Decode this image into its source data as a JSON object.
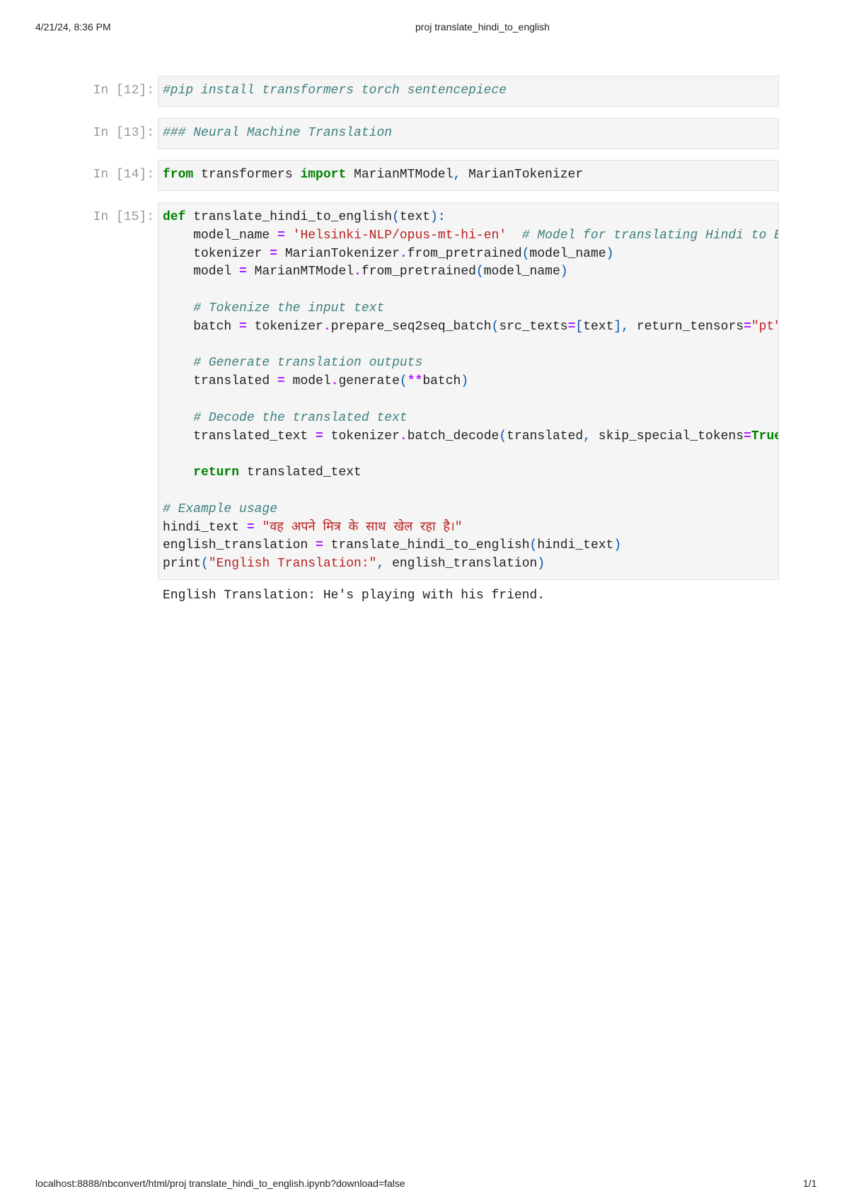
{
  "page_header": {
    "datetime": "4/21/24, 8:36 PM",
    "title": "proj translate_hindi_to_english"
  },
  "page_footer": {
    "url": "localhost:8888/nbconvert/html/proj translate_hindi_to_english.ipynb?download=false",
    "page": "1/1"
  },
  "cells": [
    {
      "prompt": "In [12]:",
      "lines": [
        [
          [
            "cm",
            "#pip install transformers torch sentencepiece"
          ]
        ]
      ]
    },
    {
      "prompt": "In [13]:",
      "lines": [
        [
          [
            "cm",
            "### Neural Machine Translation"
          ]
        ]
      ]
    },
    {
      "prompt": "In [14]:",
      "lines": [
        [
          [
            "kw",
            "from"
          ],
          [
            "n",
            " transformers "
          ],
          [
            "kw",
            "import"
          ],
          [
            "n",
            " MarianMTModel"
          ],
          [
            "p",
            ","
          ],
          [
            "n",
            " MarianTokenizer"
          ]
        ]
      ]
    },
    {
      "prompt": "In [15]:",
      "lines": [
        [
          [
            "kw",
            "def"
          ],
          [
            "n",
            " translate_hindi_to_english"
          ],
          [
            "p",
            "("
          ],
          [
            "n",
            "text"
          ],
          [
            "p",
            "):"
          ]
        ],
        [
          [
            "n",
            "    model_name "
          ],
          [
            "op",
            "="
          ],
          [
            "n",
            " "
          ],
          [
            "str",
            "'Helsinki-NLP/opus-mt-hi-en'"
          ],
          [
            "n",
            "  "
          ],
          [
            "cm",
            "# Model for translating Hindi to English"
          ]
        ],
        [
          [
            "n",
            "    tokenizer "
          ],
          [
            "op",
            "="
          ],
          [
            "n",
            " MarianTokenizer"
          ],
          [
            "op",
            "."
          ],
          [
            "n",
            "from_pretrained"
          ],
          [
            "p",
            "("
          ],
          [
            "n",
            "model_name"
          ],
          [
            "p",
            ")"
          ]
        ],
        [
          [
            "n",
            "    model "
          ],
          [
            "op",
            "="
          ],
          [
            "n",
            " MarianMTModel"
          ],
          [
            "op",
            "."
          ],
          [
            "n",
            "from_pretrained"
          ],
          [
            "p",
            "("
          ],
          [
            "n",
            "model_name"
          ],
          [
            "p",
            ")"
          ]
        ],
        [
          [
            "n",
            " "
          ]
        ],
        [
          [
            "n",
            "    "
          ],
          [
            "cm",
            "# Tokenize the input text"
          ]
        ],
        [
          [
            "n",
            "    batch "
          ],
          [
            "op",
            "="
          ],
          [
            "n",
            " tokenizer"
          ],
          [
            "op",
            "."
          ],
          [
            "n",
            "prepare_seq2seq_batch"
          ],
          [
            "p",
            "("
          ],
          [
            "n",
            "src_texts"
          ],
          [
            "op",
            "="
          ],
          [
            "p",
            "["
          ],
          [
            "n",
            "text"
          ],
          [
            "p",
            "],"
          ],
          [
            "n",
            " return_tensors"
          ],
          [
            "op",
            "="
          ],
          [
            "str",
            "\"pt\""
          ],
          [
            "p",
            ")"
          ]
        ],
        [
          [
            "n",
            " "
          ]
        ],
        [
          [
            "n",
            "    "
          ],
          [
            "cm",
            "# Generate translation outputs"
          ]
        ],
        [
          [
            "n",
            "    translated "
          ],
          [
            "op",
            "="
          ],
          [
            "n",
            " model"
          ],
          [
            "op",
            "."
          ],
          [
            "n",
            "generate"
          ],
          [
            "p",
            "("
          ],
          [
            "op",
            "**"
          ],
          [
            "n",
            "batch"
          ],
          [
            "p",
            ")"
          ]
        ],
        [
          [
            "n",
            " "
          ]
        ],
        [
          [
            "n",
            "    "
          ],
          [
            "cm",
            "# Decode the translated text"
          ]
        ],
        [
          [
            "n",
            "    translated_text "
          ],
          [
            "op",
            "="
          ],
          [
            "n",
            " tokenizer"
          ],
          [
            "op",
            "."
          ],
          [
            "n",
            "batch_decode"
          ],
          [
            "p",
            "("
          ],
          [
            "n",
            "translated"
          ],
          [
            "p",
            ","
          ],
          [
            "n",
            " skip_special_tokens"
          ],
          [
            "op",
            "="
          ],
          [
            "kw",
            "True"
          ],
          [
            "p",
            ")"
          ]
        ],
        [
          [
            "n",
            " "
          ]
        ],
        [
          [
            "n",
            "    "
          ],
          [
            "kw",
            "return"
          ],
          [
            "n",
            " translated_text"
          ]
        ],
        [
          [
            "n",
            " "
          ]
        ],
        [
          [
            "cm",
            "# Example usage"
          ]
        ],
        [
          [
            "n",
            "hindi_text "
          ],
          [
            "op",
            "="
          ],
          [
            "n",
            " "
          ],
          [
            "str",
            "\"वह अपने मित्र के साथ खेल रहा है।\""
          ]
        ],
        [
          [
            "n",
            "english_translation "
          ],
          [
            "op",
            "="
          ],
          [
            "n",
            " translate_hindi_to_english"
          ],
          [
            "p",
            "("
          ],
          [
            "n",
            "hindi_text"
          ],
          [
            "p",
            ")"
          ]
        ],
        [
          [
            "n",
            "print"
          ],
          [
            "p",
            "("
          ],
          [
            "str",
            "\"English Translation:\""
          ],
          [
            "p",
            ","
          ],
          [
            "n",
            " english_translation"
          ],
          [
            "p",
            ")"
          ]
        ]
      ]
    }
  ],
  "output": {
    "text": "English Translation: He's playing with his friend."
  }
}
